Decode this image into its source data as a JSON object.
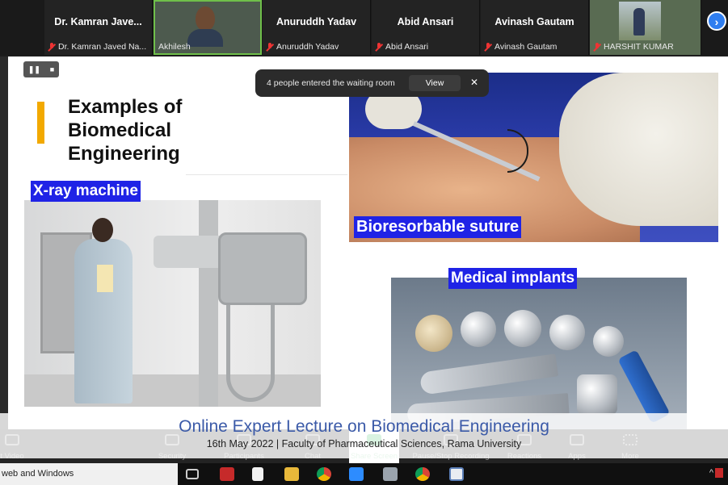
{
  "participants": [
    {
      "display_name": "Dr. Kamran Jave...",
      "label": "Dr. Kamran Javed Na...",
      "muted": true
    },
    {
      "display_name": "",
      "label": "Akhilesh",
      "muted": false
    },
    {
      "display_name": "Anuruddh Yadav",
      "label": "Anuruddh Yadav",
      "muted": true
    },
    {
      "display_name": "Abid Ansari",
      "label": "Abid Ansari",
      "muted": true
    },
    {
      "display_name": "Avinash Gautam",
      "label": "Avinash Gautam",
      "muted": true
    },
    {
      "display_name": "",
      "label": "HARSHIT KUMAR",
      "muted": true
    }
  ],
  "strip": {
    "next_icon": "chevron-right-icon",
    "next_glyph": "›"
  },
  "share_controls": {
    "pause_glyph": "❚❚",
    "stop_glyph": "■"
  },
  "notification": {
    "message": "4 people entered the waiting room",
    "view_label": "View",
    "close_glyph": "✕"
  },
  "slide": {
    "title": "Examples of Biomedical Engineering",
    "accent_color": "#f2a900",
    "caption_color": "#1f23e6",
    "captions": {
      "xray": "X-ray machine",
      "suture": "Bioresorbable suture",
      "implants": "Medical implants"
    }
  },
  "banner": {
    "title": "Online Expert Lecture on Biomedical Engineering",
    "subtitle": "16th May 2022  | Faculty of Pharmaceutical Sciences, Rama University"
  },
  "toolbar": {
    "items": [
      {
        "label": "t Video",
        "icon": "video-icon"
      },
      {
        "label": "Security",
        "icon": "shield-icon"
      },
      {
        "label": "Participants",
        "icon": "participants-icon"
      },
      {
        "label": "Chat",
        "icon": "chat-icon"
      },
      {
        "label": "Share Screen",
        "icon": "share-screen-icon"
      },
      {
        "label": "Pause/Stop Recording",
        "icon": "record-icon"
      },
      {
        "label": "Reactions",
        "icon": "reactions-icon"
      },
      {
        "label": "Apps",
        "icon": "apps-icon"
      },
      {
        "label": "More",
        "icon": "more-icon"
      }
    ]
  },
  "taskbar": {
    "search_text": "web and Windows",
    "apps": [
      "task-view-icon",
      "acrobat-icon",
      "file-icon",
      "file-explorer-icon",
      "chrome-icon",
      "zoom-icon",
      "app-icon",
      "chrome-alt-icon",
      "document-icon"
    ],
    "tray_glyph": "^"
  }
}
